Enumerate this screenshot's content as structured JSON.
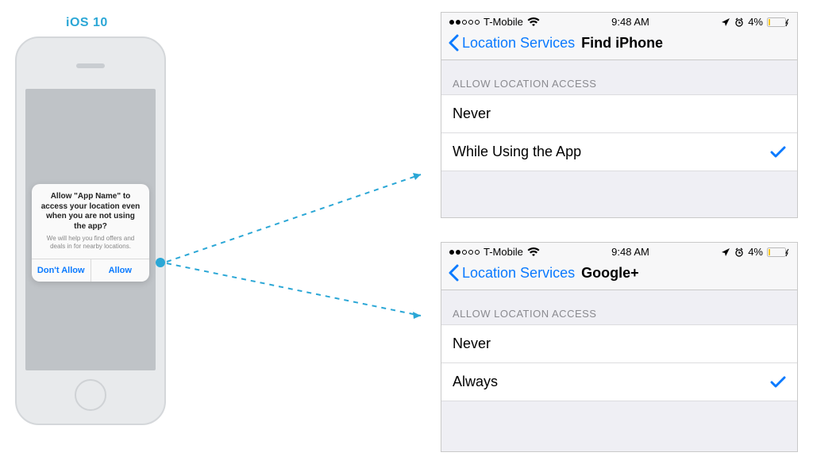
{
  "label_ios": "iOS 10",
  "dialog": {
    "title": "Allow \"App Name\" to access your location even when you are not using the app?",
    "subtitle": "We will help you find offers and deals in for nearby locations.",
    "deny": "Don't Allow",
    "allow": "Allow"
  },
  "status": {
    "carrier": "T-Mobile",
    "time": "9:48 AM",
    "battery": "4%"
  },
  "panel1": {
    "back": "Location Services",
    "title": "Find iPhone",
    "section": "ALLOW LOCATION ACCESS",
    "rows": [
      {
        "label": "Never",
        "checked": false
      },
      {
        "label": "While Using the App",
        "checked": true
      }
    ]
  },
  "panel2": {
    "back": "Location Services",
    "title": "Google+",
    "section": "ALLOW LOCATION ACCESS",
    "rows": [
      {
        "label": "Never",
        "checked": false
      },
      {
        "label": "Always",
        "checked": true
      }
    ]
  }
}
